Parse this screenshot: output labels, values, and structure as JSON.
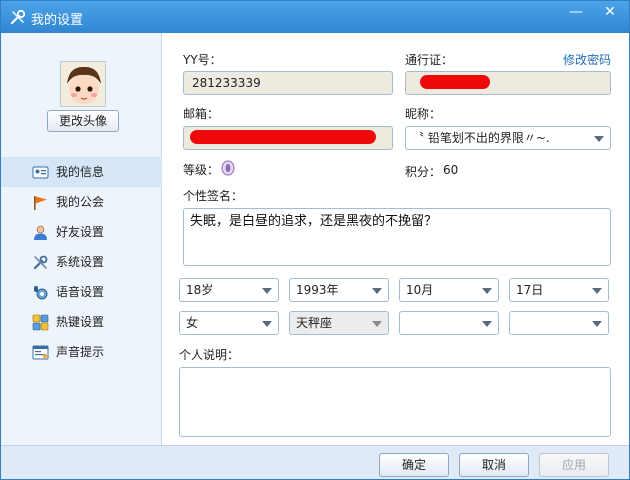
{
  "window": {
    "title": "我的设置",
    "minimize": "—",
    "close": "✕"
  },
  "sidebar": {
    "avatar_button": "更改头像",
    "items": [
      {
        "label": "我的信息",
        "icon": "id-card-icon"
      },
      {
        "label": "我的公会",
        "icon": "flag-icon"
      },
      {
        "label": "好友设置",
        "icon": "user-icon"
      },
      {
        "label": "系统设置",
        "icon": "tools-icon"
      },
      {
        "label": "语音设置",
        "icon": "voice-gear-icon"
      },
      {
        "label": "热键设置",
        "icon": "keyboard-icon"
      },
      {
        "label": "声音提示",
        "icon": "sound-prompt-icon"
      }
    ]
  },
  "profile": {
    "yy_label": "YY号：",
    "yy_value": "281233339",
    "passport_label": "通行证：",
    "change_password": "修改密码",
    "email_label": "邮箱：",
    "nickname_label": "昵称：",
    "nickname_value": "〝 铅笔划不出的界限〃~.",
    "level_label": "等级：",
    "points_label": "积分：",
    "points_value": "60",
    "signature_label": "个性签名：",
    "signature_value": "失眠，是白昼的追求，还是黑夜的不挽留？",
    "age": "18岁",
    "year": "1993年",
    "month": "10月",
    "day": "17日",
    "gender": "女",
    "zodiac": "天秤座",
    "blank1": "",
    "blank2": "",
    "description_label": "个人说明：",
    "description_value": ""
  },
  "footer": {
    "ok": "确定",
    "cancel": "取消",
    "apply": "应用"
  },
  "colors": {
    "titlebar": "#2f87d4",
    "link": "#1f6fb3",
    "redaction": "#ee0a0a"
  }
}
